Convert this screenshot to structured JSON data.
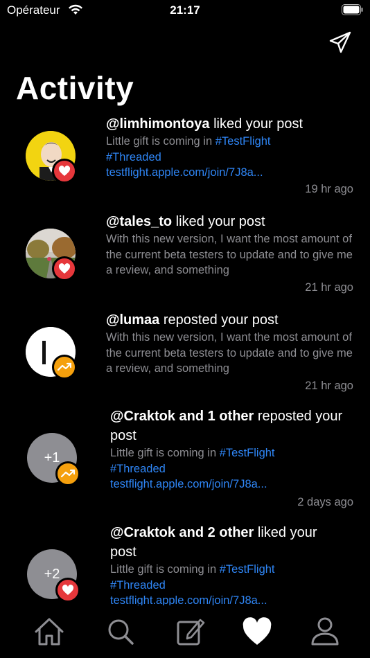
{
  "status_bar": {
    "carrier": "Opérateur",
    "time": "21:17"
  },
  "header": {
    "title": "Activity"
  },
  "notifications": [
    {
      "user": "@limhimontoya",
      "action": " liked your post",
      "body_plain": "Little gift is coming in ",
      "hashtag1": "#TestFlight",
      "hashtag2": "#Threaded",
      "link": "testflight.apple.com/join/7J8a...",
      "time": "19 hr ago",
      "type": "like"
    },
    {
      "user": "@tales_to",
      "action": " liked your post",
      "body": "With this new version, I want the most amount of the current beta testers to update and to give me a review, and something",
      "time": "21 hr ago",
      "type": "like"
    },
    {
      "user": "@lumaa",
      "action": " reposted your post",
      "body": "With this new version, I want the most amount of the current beta testers to update and to give me a review, and something",
      "time": "21 hr ago",
      "type": "repost"
    },
    {
      "user": "@Craktok and 1 other",
      "action": " reposted your post",
      "body_plain": "Little gift is coming in ",
      "hashtag1": "#TestFlight",
      "hashtag2": "#Threaded",
      "link": "testflight.apple.com/join/7J8a...",
      "time": "2 days ago",
      "type": "repost",
      "avatar_count": "+1"
    },
    {
      "user": "@Craktok and 2 other",
      "action": " liked your post",
      "body_plain": "Little gift is coming in ",
      "hashtag1": "#TestFlight",
      "hashtag2": "#Threaded",
      "link": "testflight.apple.com/join/7J8a...",
      "time": "",
      "type": "like",
      "avatar_count": "+2"
    }
  ],
  "colors": {
    "like": "#e6373b",
    "repost": "#f5a00d",
    "link": "#2f86f6",
    "secondary_text": "#8e8e93"
  },
  "tabbar": {
    "items": [
      {
        "icon": "home-icon",
        "active": false
      },
      {
        "icon": "search-icon",
        "active": false
      },
      {
        "icon": "compose-icon",
        "active": false
      },
      {
        "icon": "heart-icon",
        "active": true
      },
      {
        "icon": "profile-icon",
        "active": false
      }
    ]
  }
}
